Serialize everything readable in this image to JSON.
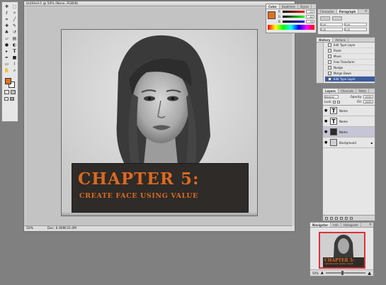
{
  "document": {
    "title": "Untitled-1 @ 50% (None, RGB/8)",
    "status_zoom": "50%",
    "status_doc": "Doc: 6.00M/31.0M"
  },
  "banner": {
    "title": "CHAPTER 5:",
    "subtitle": "CREATE FACE USING VALUE"
  },
  "colors": {
    "accent": "#dc6a20",
    "banner_bg": "#2e2b28",
    "foreground": "#e07020"
  },
  "color_panel": {
    "tabs": [
      "Color",
      "Swatches",
      "Styles"
    ],
    "channels": [
      {
        "label": "R",
        "value": "22"
      },
      {
        "label": "G",
        "value": "82"
      },
      {
        "label": "B",
        "value": "94"
      }
    ]
  },
  "swatch_panel": {
    "tabs": [
      "Character",
      "Paragraph"
    ],
    "fields": [
      "0 pt",
      "0 pt",
      "0 pt",
      "0 pt"
    ]
  },
  "history_panel": {
    "tabs": [
      "History",
      "Actions"
    ],
    "items": [
      {
        "label": "Edit Type Layer",
        "active": false
      },
      {
        "label": "Paste",
        "active": false
      },
      {
        "label": "Move",
        "active": false
      },
      {
        "label": "Free Transform",
        "active": false
      },
      {
        "label": "Nudge",
        "active": false
      },
      {
        "label": "Merge Down",
        "active": false
      },
      {
        "label": "Edit Type Layer",
        "active": true
      }
    ]
  },
  "layers_panel": {
    "tabs": [
      "Layers",
      "Channels",
      "Paths"
    ],
    "blend_mode": "Normal",
    "opacity_label": "Opacity:",
    "opacity_value": "100%",
    "lock_label": "Lock:",
    "fill_label": "Fill:",
    "fill_value": "100%",
    "layers": [
      {
        "name": "Name",
        "type": "text",
        "active": false
      },
      {
        "name": "Name",
        "type": "text",
        "active": false
      },
      {
        "name": "Name",
        "type": "image",
        "active": true
      },
      {
        "name": "Background",
        "type": "image",
        "active": false
      }
    ]
  },
  "nav_panel": {
    "tabs": [
      "Navigator",
      "Info",
      "Histogram"
    ],
    "zoom": "50%",
    "mini_title": "CHAPTER 5:",
    "mini_sub": "CREATE FACE USING VALUE"
  },
  "toolbox": {
    "tools": [
      "move-tool-icon",
      "marquee-tool-icon",
      "lasso-tool-icon",
      "wand-tool-icon",
      "crop-tool-icon",
      "slice-tool-icon",
      "heal-tool-icon",
      "brush-tool-icon",
      "stamp-tool-icon",
      "history-brush-icon",
      "eraser-tool-icon",
      "gradient-tool-icon",
      "blur-tool-icon",
      "dodge-tool-icon",
      "path-select-icon",
      "type-tool-icon",
      "pen-tool-icon",
      "shape-tool-icon",
      "notes-tool-icon",
      "eyedropper-tool-icon",
      "hand-tool-icon",
      "zoom-tool-icon"
    ]
  }
}
